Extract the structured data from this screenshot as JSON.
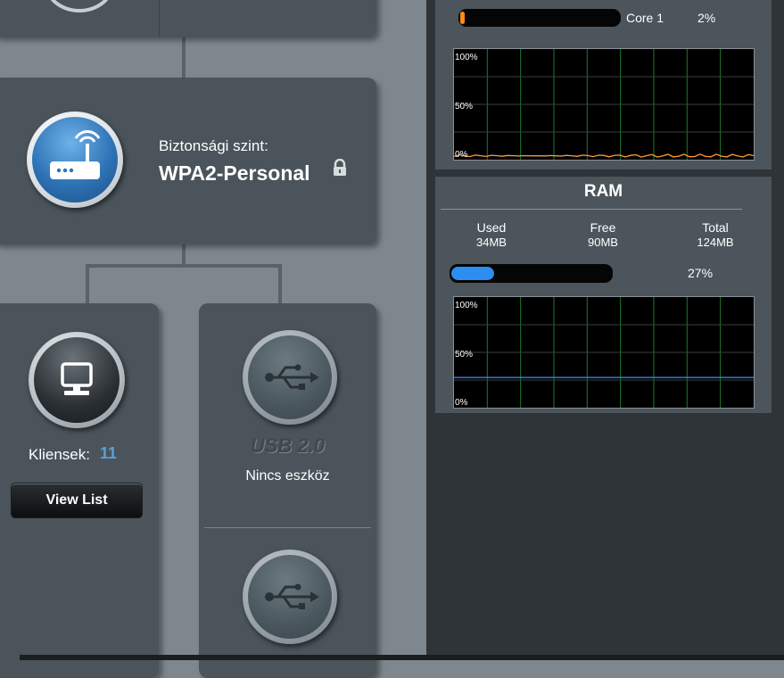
{
  "security": {
    "label": "Biztonsági szint:",
    "value": "WPA2-Personal",
    "lock_icon": "lock-icon",
    "router_icon": "router-icon"
  },
  "clients": {
    "label": "Kliensek:",
    "count": "11",
    "button": "View List",
    "icon": "monitor-icon"
  },
  "usb": {
    "port1": {
      "label": "USB 2.0",
      "status": "Nincs eszköz",
      "icon": "usb-icon"
    },
    "port2": {
      "icon": "usb-icon"
    }
  },
  "cpu": {
    "core_label": "Core 1",
    "percent_text": "2%",
    "percent": 2,
    "graph_labels": [
      "100%",
      "50%",
      "0%"
    ],
    "line_color": "#ff9c3a",
    "bar_color": "#ff8c1a"
  },
  "ram": {
    "title": "RAM",
    "used_label": "Used",
    "used_value": "34MB",
    "free_label": "Free",
    "free_value": "90MB",
    "total_label": "Total",
    "total_value": "124MB",
    "percent_text": "27%",
    "percent": 27,
    "graph_labels": [
      "100%",
      "50%",
      "0%"
    ],
    "line_color": "#3b8fff",
    "bar_color": "#2b8ef0"
  },
  "colors": {
    "accent": "#5aa0d8",
    "panel": "#4a545a",
    "background": "#7d878d"
  }
}
